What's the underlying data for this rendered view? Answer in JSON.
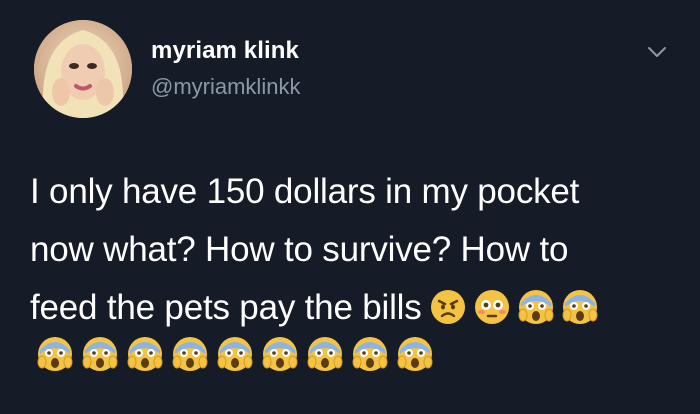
{
  "user": {
    "display_name": "myriam klink",
    "handle": "@myriamklinkk",
    "avatar_icon": "profile-photo"
  },
  "tweet": {
    "lines": [
      "I only have 150 dollars in my pocket",
      "now what? How to survive? How to",
      "feed the pets pay the bills"
    ],
    "inline_emojis": [
      "angry-face",
      "flushed-face",
      "screaming-face",
      "screaming-face"
    ],
    "emoji_row": [
      "screaming-face",
      "screaming-face",
      "screaming-face",
      "screaming-face",
      "screaming-face",
      "screaming-face",
      "screaming-face",
      "screaming-face",
      "screaming-face"
    ]
  },
  "colors": {
    "background": "#151c28",
    "text": "#ffffff",
    "muted": "#8b98a5"
  }
}
